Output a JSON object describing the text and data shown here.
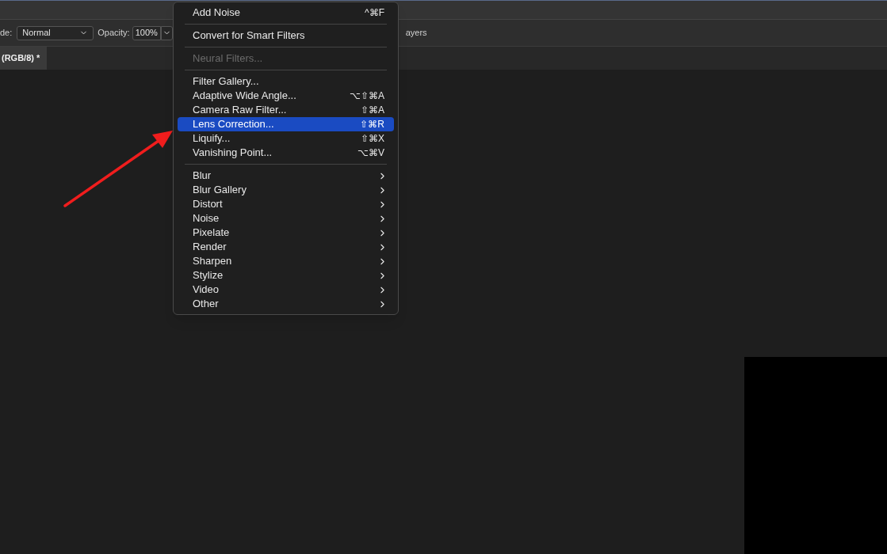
{
  "options_bar": {
    "mode_label": "de:",
    "mode_value": "Normal",
    "opacity_label": "Opacity:",
    "opacity_value": "100%",
    "layers_label": "ayers"
  },
  "document_tab": {
    "title": "(RGB/8) *",
    "selected": true
  },
  "menu": {
    "groups": [
      {
        "items": [
          {
            "kind": "command",
            "label": "Add Noise",
            "shortcut": "^⌘F",
            "disabled": false,
            "selected": false
          }
        ]
      },
      {
        "items": [
          {
            "kind": "command",
            "label": "Convert for Smart Filters",
            "disabled": false,
            "selected": false
          }
        ]
      },
      {
        "items": [
          {
            "kind": "command",
            "label": "Neural Filters...",
            "disabled": true,
            "selected": false
          }
        ]
      },
      {
        "items": [
          {
            "kind": "command",
            "label": "Filter Gallery...",
            "disabled": false,
            "selected": false
          },
          {
            "kind": "command",
            "label": "Adaptive Wide Angle...",
            "shortcut": "⌥⇧⌘A",
            "disabled": false,
            "selected": false
          },
          {
            "kind": "command",
            "label": "Camera Raw Filter...",
            "shortcut": "⇧⌘A",
            "disabled": false,
            "selected": false
          },
          {
            "kind": "command",
            "label": "Lens Correction...",
            "shortcut": "⇧⌘R",
            "disabled": false,
            "selected": true
          },
          {
            "kind": "command",
            "label": "Liquify...",
            "shortcut": "⇧⌘X",
            "disabled": false,
            "selected": false
          },
          {
            "kind": "command",
            "label": "Vanishing Point...",
            "shortcut": "⌥⌘V",
            "disabled": false,
            "selected": false
          }
        ]
      },
      {
        "items": [
          {
            "kind": "submenu",
            "label": "Blur",
            "selected": false
          },
          {
            "kind": "submenu",
            "label": "Blur Gallery",
            "selected": false
          },
          {
            "kind": "submenu",
            "label": "Distort",
            "selected": false
          },
          {
            "kind": "submenu",
            "label": "Noise",
            "selected": false
          },
          {
            "kind": "submenu",
            "label": "Pixelate",
            "selected": false
          },
          {
            "kind": "submenu",
            "label": "Render",
            "selected": false
          },
          {
            "kind": "submenu",
            "label": "Sharpen",
            "selected": false
          },
          {
            "kind": "submenu",
            "label": "Stylize",
            "selected": false
          },
          {
            "kind": "submenu",
            "label": "Video",
            "selected": false
          },
          {
            "kind": "submenu",
            "label": "Other",
            "selected": false
          }
        ]
      }
    ]
  }
}
